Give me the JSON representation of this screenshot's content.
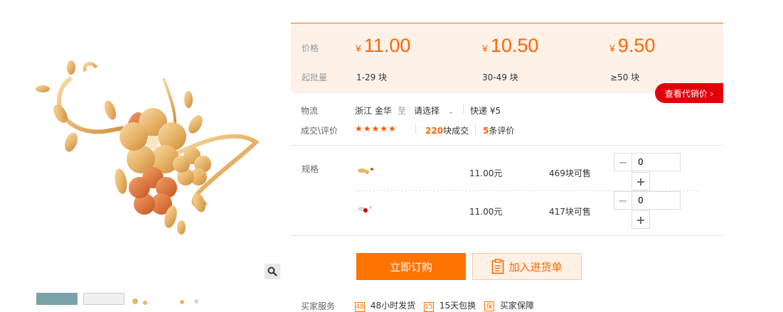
{
  "price_tiers": {
    "price_label": "价格",
    "qty_label": "起批量",
    "currency": "¥",
    "tiers": [
      {
        "price": "11.00",
        "qty": "1-29 块"
      },
      {
        "price": "10.50",
        "qty": "30-49 块"
      },
      {
        "price": "9.50",
        "qty": "≥50 块"
      }
    ],
    "agent_price_label": "查看代销价 ›"
  },
  "logistics": {
    "label": "物流",
    "origin": "浙江 金华",
    "to": "至",
    "destination": "请选择",
    "shipping": "快递 ¥5"
  },
  "reviews": {
    "label": "成交\\评价",
    "stars": "★★★★★",
    "deals_count": "220",
    "deals_text": "块成交",
    "review_count": "5",
    "review_text": "条评价"
  },
  "specs": {
    "label": "规格",
    "rows": [
      {
        "price": "11.00元",
        "stock": "469块可售",
        "qty": "0"
      },
      {
        "price": "11.00元",
        "stock": "417块可售",
        "qty": "0"
      }
    ]
  },
  "actions": {
    "buy_label": "立即订购",
    "cart_label": "加入进货单"
  },
  "services": {
    "label": "买家服务",
    "items": [
      "48小时发货",
      "15天包换",
      "买家保障"
    ],
    "icons": [
      "48",
      "15",
      "保"
    ]
  },
  "colors": {
    "accent": "#ff6600",
    "price_bg": "#fdf1e8",
    "agent_red": "#e4000a"
  }
}
